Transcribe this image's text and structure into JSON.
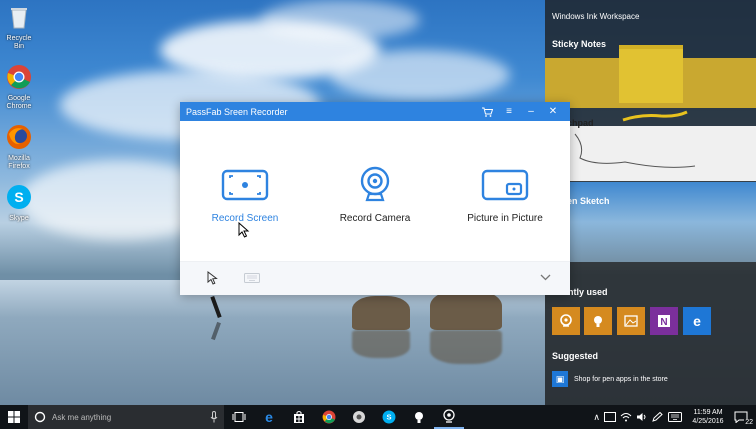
{
  "desktop_icons": [
    {
      "label": "Recycle Bin",
      "icon": "recycle-bin-icon"
    },
    {
      "label": "Google Chrome",
      "icon": "chrome-icon"
    },
    {
      "label": "Mozilla Firefox",
      "icon": "firefox-icon"
    },
    {
      "label": "Skype",
      "icon": "skype-icon"
    }
  ],
  "ink_workspace": {
    "title": "Windows Ink Workspace",
    "sticky_notes": "Sticky Notes",
    "sketchpad": "chpad",
    "screen_sketch": "en Sketch",
    "recently_used": "ently used",
    "suggested": "Suggested",
    "suggestion_text": "Shop for pen apps in the store",
    "recent_tiles": [
      {
        "icon": "maps-icon",
        "color": "#d58a1f"
      },
      {
        "icon": "tips-icon",
        "color": "#d58a1f"
      },
      {
        "icon": "photos-icon",
        "color": "#d58a1f"
      },
      {
        "icon": "onenote-icon",
        "color": "#7b2f9c"
      },
      {
        "icon": "edge-icon",
        "color": "#1e77d6"
      }
    ]
  },
  "recorder": {
    "title": "PassFab Sreen Recorder",
    "accent": "#2e83e0",
    "modes": [
      {
        "label": "Record Screen",
        "icon": "record-screen-icon",
        "active": true
      },
      {
        "label": "Record Camera",
        "icon": "webcam-icon",
        "active": false
      },
      {
        "label": "Picture in Picture",
        "icon": "picture-in-picture-icon",
        "active": false
      }
    ]
  },
  "taskbar": {
    "search_placeholder": "Ask me anything",
    "time": "11:59 AM",
    "date": "4/25/2016",
    "notification_count": "22"
  }
}
